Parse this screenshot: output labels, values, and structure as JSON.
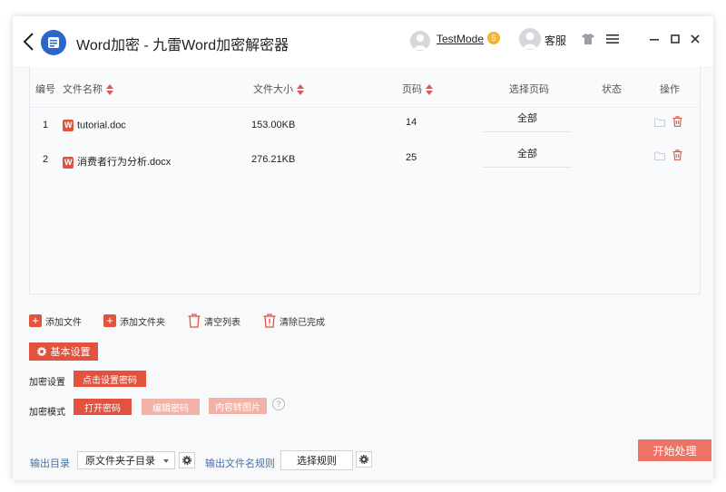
{
  "window": {
    "title": "Word加密 - 九雷Word加密解密器"
  },
  "header": {
    "user_name": "TestMode",
    "vip_level": "5",
    "service_label": "客服"
  },
  "table": {
    "columns": {
      "index": "编号",
      "name": "文件名称",
      "size": "文件大小",
      "pages": "页码",
      "select_pages": "选择页码",
      "status": "状态",
      "actions": "操作"
    },
    "rows": [
      {
        "index": "1",
        "name": "tutorial.doc",
        "size": "153.00KB",
        "pages": "14",
        "select_pages": "全部",
        "status": ""
      },
      {
        "index": "2",
        "name": "消费者行为分析.docx",
        "size": "276.21KB",
        "pages": "25",
        "select_pages": "全部",
        "status": ""
      }
    ]
  },
  "toolbar": {
    "add_file": "添加文件",
    "add_folder": "添加文件夹",
    "clear_list": "清空列表",
    "clear_done": "清除已完成"
  },
  "settings": {
    "title": "基本设置",
    "encrypt_setting_label": "加密设置",
    "set_password_button": "点击设置密码",
    "encrypt_mode_label": "加密模式",
    "modes": {
      "open": "打开密码",
      "edit": "编辑密码",
      "to_image": "内容转图片"
    },
    "help_glyph": "?"
  },
  "footer": {
    "output_dir_label": "输出目录",
    "output_dir_value": "原文件夹子目录",
    "output_name_label": "输出文件名规则",
    "rule_button": "选择规则",
    "start_button": "开始处理"
  },
  "colors": {
    "accent": "#e2523f",
    "accent_light": "#f3b2a7",
    "start_button": "#ec7366",
    "link_blue": "#4a6fa5",
    "app_logo": "#2b66c9"
  },
  "icons": [
    "back-arrow-icon",
    "app-logo-icon",
    "user-avatar-icon",
    "vip-badge-icon",
    "service-avatar-icon",
    "skin-shirt-icon",
    "menu-icon",
    "minimize-icon",
    "maximize-icon",
    "close-icon",
    "sort-icon",
    "word-file-icon",
    "folder-open-icon",
    "trash-icon",
    "plus-icon",
    "gear-icon"
  ]
}
